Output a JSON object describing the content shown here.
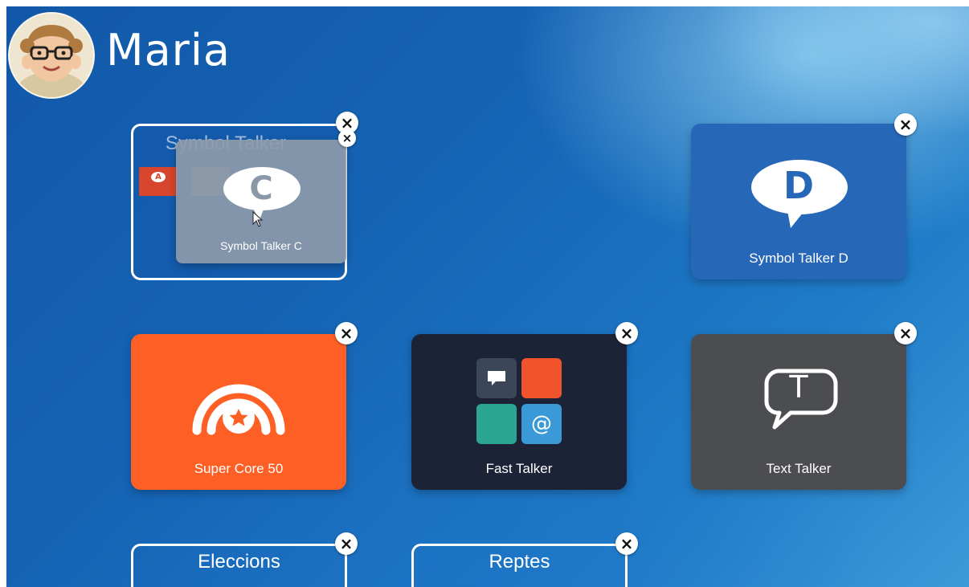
{
  "user": {
    "name": "Maria"
  },
  "tiles": {
    "symbol_talker_folder": {
      "title": "Symbol Talker"
    },
    "symbol_talker_c": {
      "label": "Symbol Talker C",
      "letter": "C"
    },
    "symbol_talker_d": {
      "label": "Symbol Talker D",
      "letter": "D"
    },
    "super_core_50": {
      "label": "Super Core 50"
    },
    "fast_talker": {
      "label": "Fast Talker",
      "at_symbol": "@"
    },
    "text_talker": {
      "label": "Text Talker",
      "letter": "T"
    },
    "eleccions": {
      "label": "Eleccions"
    },
    "reptes": {
      "label": "Reptes"
    }
  },
  "close_symbol": "×",
  "mini_icons": {
    "a": "A"
  },
  "colors": {
    "symbol_talker_d": "#2767b8",
    "super_core_50": "#fd5f24",
    "fast_talker": "#1c2336",
    "text_talker": "#4b4d50",
    "dragging_tile": "#8a98a8",
    "fast_red": "#f1532d",
    "fast_teal": "#2aa693",
    "fast_blue": "#3a9ad8",
    "fast_dark": "#3b4759"
  }
}
